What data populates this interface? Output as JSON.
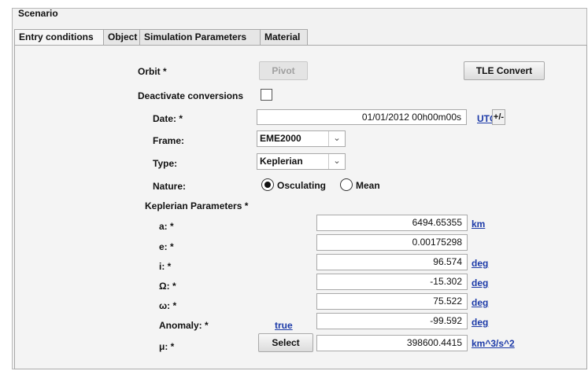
{
  "panel": {
    "title": "Scenario"
  },
  "tabs": [
    {
      "label": "Entry conditions",
      "active": true
    },
    {
      "label": "Object",
      "active": false
    },
    {
      "label": "Simulation Parameters",
      "active": false
    },
    {
      "label": "Material",
      "active": false
    }
  ],
  "orbit": {
    "label": "Orbit *",
    "pivot_label": "Pivot",
    "tle_label": "TLE Convert"
  },
  "conversions": {
    "label": "Deactivate conversions",
    "checked": false
  },
  "date": {
    "label": "Date: *",
    "value": "01/01/2012 00h00m00s",
    "tz_label": "UTC",
    "pm_label": "+/-"
  },
  "frame": {
    "label": "Frame:",
    "value": "EME2000"
  },
  "type": {
    "label": "Type:",
    "value": "Keplerian"
  },
  "nature": {
    "label": "Nature:",
    "options": [
      "Osculating",
      "Mean"
    ],
    "selected": "Osculating"
  },
  "keplerian": {
    "title": "Keplerian Parameters *",
    "a": {
      "label": "a: *",
      "value": "6494.65355",
      "unit": "km"
    },
    "e": {
      "label": "e: *",
      "value": "0.00175298"
    },
    "i": {
      "label": "i: *",
      "value": "96.574",
      "unit": "deg"
    },
    "raan": {
      "label": "Ω: *",
      "value": "-15.302",
      "unit": "deg"
    },
    "argp": {
      "label": "ω: *",
      "value": "75.522",
      "unit": "deg"
    },
    "anomaly": {
      "label": "Anomaly: *",
      "kind": "true",
      "value": "-99.592",
      "unit": "deg"
    },
    "mu": {
      "label": "μ: *",
      "select_label": "Select",
      "value": "398600.4415",
      "unit": "km^3/s^2"
    }
  },
  "icons": {
    "dropdown": "chevron-down-icon",
    "checkbox": "checkbox-icon"
  }
}
